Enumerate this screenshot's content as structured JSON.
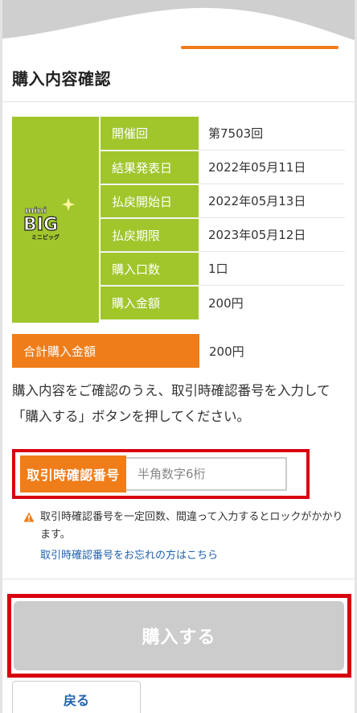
{
  "header": {
    "title": "購入内容確認"
  },
  "logo": {
    "line1": "mini",
    "line2": "BIG",
    "line3": "ミニビッグ"
  },
  "details": [
    {
      "label": "開催回",
      "value": "第7503回"
    },
    {
      "label": "結果発表日",
      "value": "2022年05月11日"
    },
    {
      "label": "払戻開始日",
      "value": "2022年05月13日"
    },
    {
      "label": "払戻期限",
      "value": "2023年05月12日"
    },
    {
      "label": "購入口数",
      "value": "1口"
    },
    {
      "label": "購入金額",
      "value": "200円"
    }
  ],
  "total": {
    "label": "合計購入金額",
    "value": "200円"
  },
  "instruction": "購入内容をご確認のうえ、取引時確認番号を入力して「購入する」ボタンを押してください。",
  "pin": {
    "label": "取引時確認番号",
    "placeholder": "半角数字6桁",
    "value": ""
  },
  "warning": {
    "text": "取引時確認番号を一定回数、間違って入力するとロックがかかります。"
  },
  "forgot_link": "取引時確認番号をお忘れの方はこちら",
  "buttons": {
    "buy": "購入する",
    "back": "戻る"
  },
  "colors": {
    "accent_green": "#a0c62c",
    "accent_orange": "#ef7d1a",
    "highlight_red": "#d8000f",
    "link_blue": "#2062b0"
  }
}
